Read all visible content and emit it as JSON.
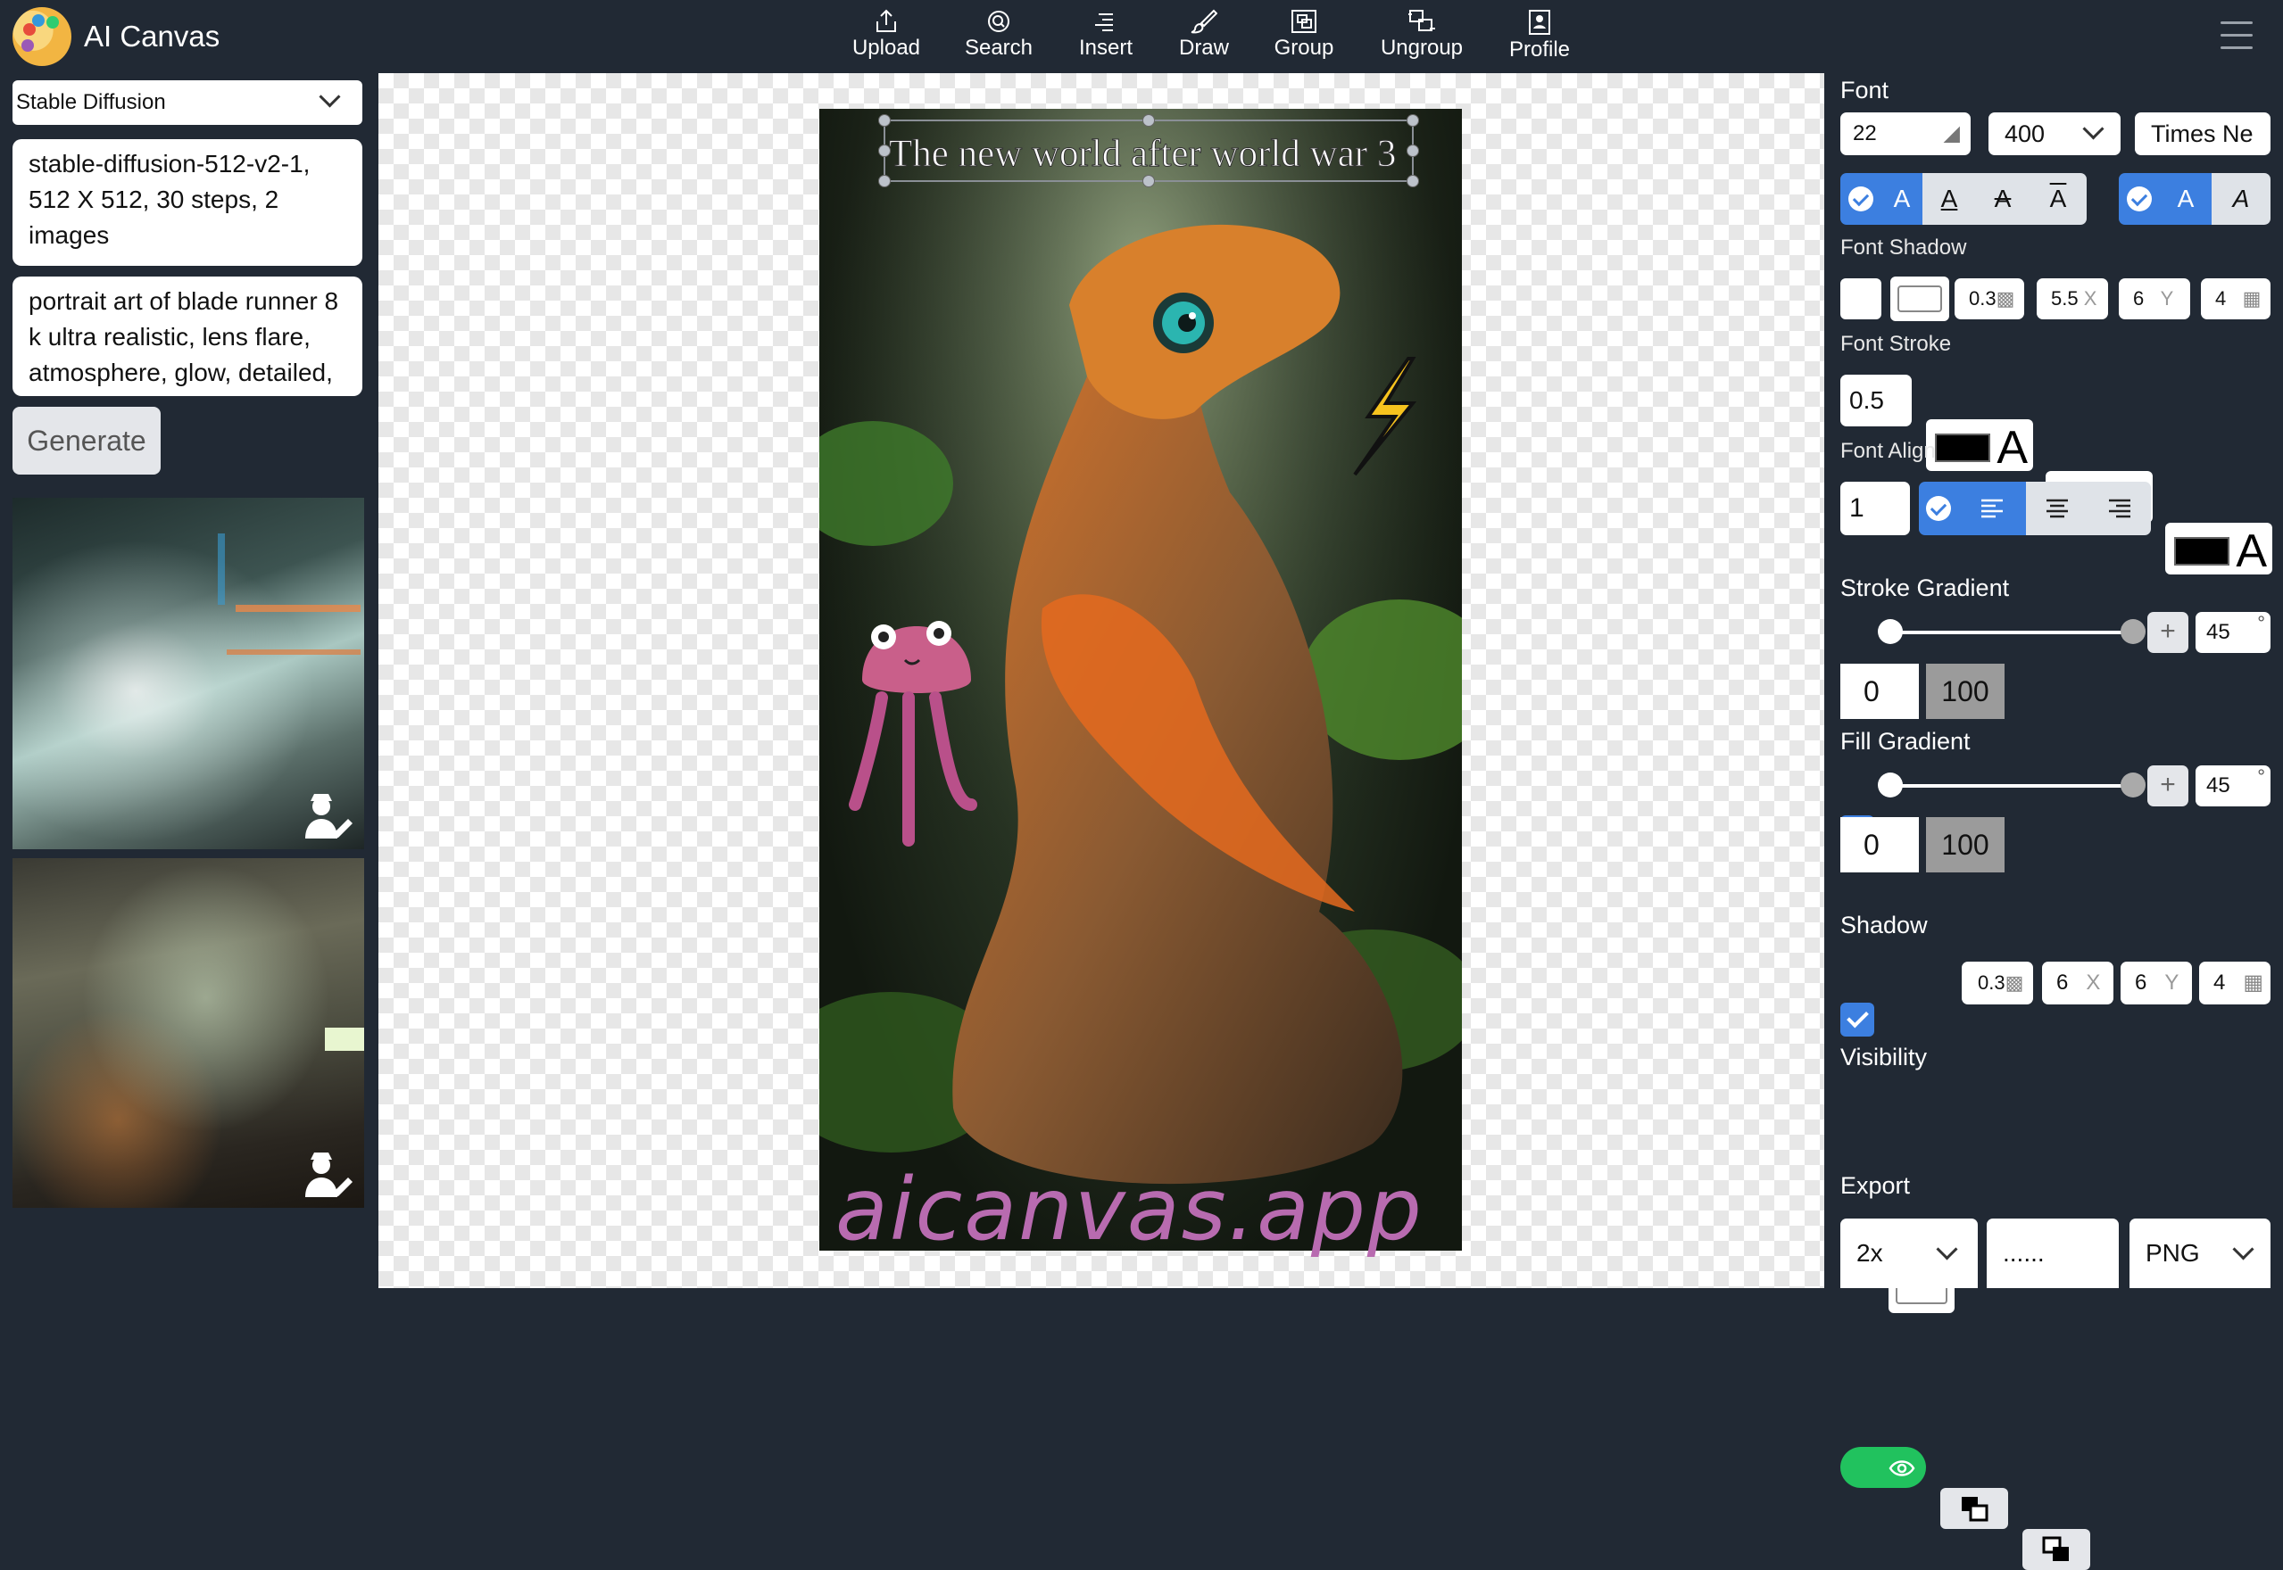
{
  "app": {
    "title": "AI Canvas"
  },
  "toolbar": {
    "upload": "Upload",
    "search": "Search",
    "insert": "Insert",
    "draw": "Draw",
    "group": "Group",
    "ungroup": "Ungroup",
    "profile": "Profile"
  },
  "sidebar": {
    "model": "Stable Diffusion",
    "settings": "stable-diffusion-512-v2-1, 512 X 512, 30 steps, 2 images",
    "prompt": "portrait art of blade runner 8 k ultra realistic, lens flare, atmosphere, glow, detailed,",
    "generate": "Generate"
  },
  "canvas": {
    "caption": "The new world after world war 3",
    "watermark": "aicanvas.app"
  },
  "panel": {
    "font": {
      "label": "Font",
      "size": "22",
      "weight": "400",
      "family": "Times Ne",
      "letter": "A"
    },
    "font_shadow": {
      "label": "Font Shadow",
      "opacity": "0.3",
      "x": "5.5",
      "x_unit": "X",
      "y": "6",
      "y_unit": "Y",
      "blur": "4"
    },
    "font_stroke": {
      "label": "Font Stroke",
      "width": "0.5"
    },
    "font_align": {
      "label": "Font Align",
      "line_height": "1"
    },
    "stroke_gradient": {
      "label": "Stroke Gradient",
      "angle": "45",
      "deg": "°",
      "start": "0",
      "end": "100",
      "plus": "+"
    },
    "fill_gradient": {
      "label": "Fill Gradient",
      "angle": "45",
      "deg": "°",
      "start": "0",
      "end": "100",
      "plus": "+"
    },
    "shadow": {
      "label": "Shadow",
      "opacity": "0.3",
      "x": "6",
      "x_unit": "X",
      "y": "6",
      "y_unit": "Y",
      "blur": "4"
    },
    "visibility": {
      "label": "Visibility"
    },
    "export": {
      "label": "Export",
      "scale": "2x",
      "name": "......",
      "format": "PNG"
    }
  }
}
